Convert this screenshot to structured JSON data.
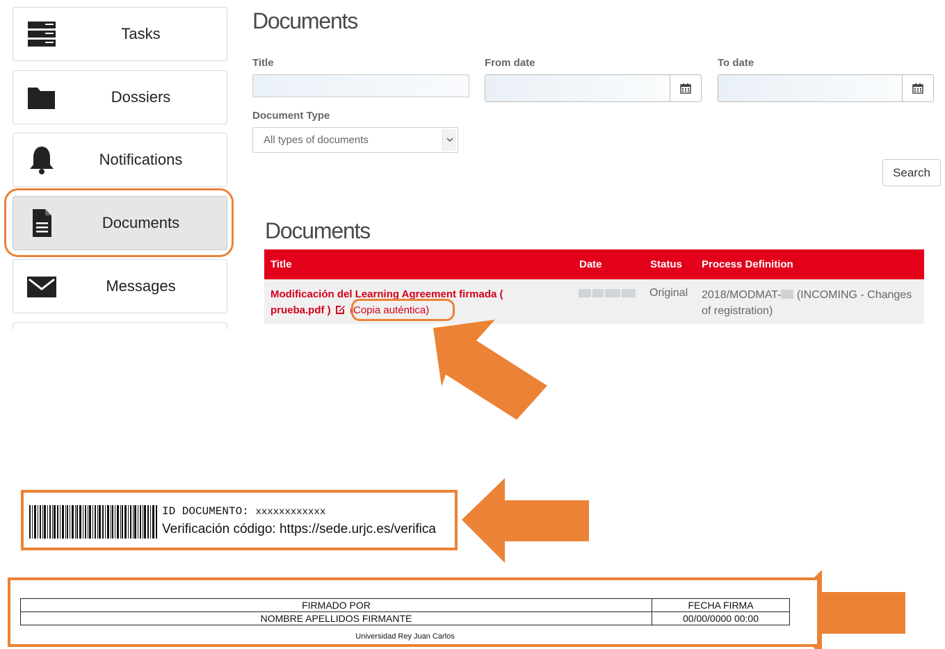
{
  "sidebar": {
    "items": [
      {
        "label": "Tasks",
        "icon": "tasks-icon"
      },
      {
        "label": "Dossiers",
        "icon": "folder-icon"
      },
      {
        "label": "Notifications",
        "icon": "bell-icon"
      },
      {
        "label": "Documents",
        "icon": "document-icon",
        "active": true
      },
      {
        "label": "Messages",
        "icon": "envelope-icon"
      }
    ]
  },
  "search_form": {
    "heading": "Documents",
    "title_label": "Title",
    "title_value": "",
    "from_date_label": "From date",
    "from_date_value": "",
    "to_date_label": "To date",
    "to_date_value": "",
    "document_type_label": "Document Type",
    "document_type_selected": "All types of documents",
    "search_label": "Search"
  },
  "results": {
    "heading": "Documents",
    "columns": [
      "Title",
      "Date",
      "Status",
      "Process Definition"
    ],
    "rows": [
      {
        "title_line1": "Modificación del Learning Agreement firmada (",
        "title_line2": "prueba.pdf )",
        "copy_link": "(Copia auténtica)",
        "status": "Original",
        "process_prefix": "2018/MODMAT-",
        "process_suffix": " (INCOMING - Changes of registration)"
      }
    ]
  },
  "stamp": {
    "id_label": "ID DOCUMENTO:",
    "id_value": "xxxxxxxxxxxx",
    "verification": "Verificación código: https://sede.urjc.es/verifica"
  },
  "signature": {
    "signed_by_header": "FIRMADO POR",
    "date_header": "FECHA FIRMA",
    "signer": "NOMBRE APELLIDOS FIRMANTE",
    "date": "00/00/0000 00:00",
    "institution": "Universidad Rey Juan Carlos"
  },
  "colors": {
    "accent_red": "#e3001b",
    "highlight_orange": "#ec8235"
  }
}
